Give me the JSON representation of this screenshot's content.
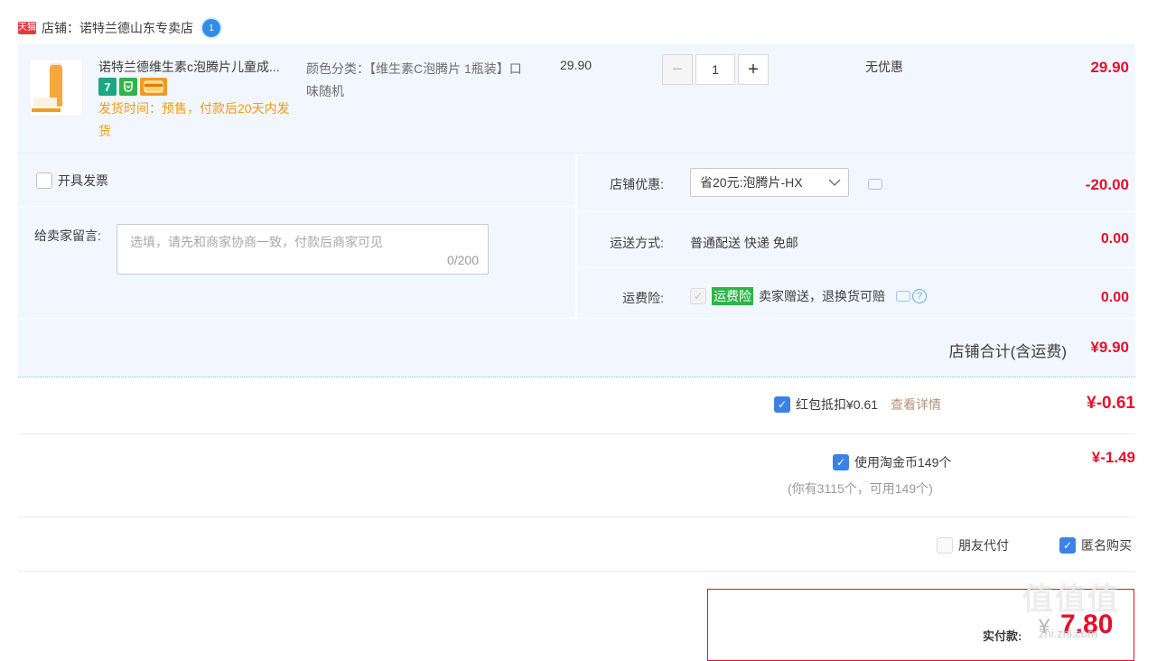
{
  "shop": {
    "tmall_badge": "天猫",
    "label": "店铺：诺特兰德山东专卖店",
    "wangwang_badge": "1"
  },
  "item": {
    "title": "诺特兰德维生素c泡腾片儿童成...",
    "badge_7": "7",
    "ship_time": "发货时间：预售，付款后20天内发货",
    "spec": "颜色分类：【维生素C泡腾片 1瓶装】口味随机",
    "price": "29.90",
    "quantity": "1",
    "qty_minus": "−",
    "qty_plus": "+",
    "discount": "无优惠",
    "total": "29.90"
  },
  "options": {
    "invoice_label": "开具发票",
    "message_label": "给卖家留言:",
    "message_placeholder": "选填，请先和商家协商一致，付款后商家可见",
    "message_count": "0/200",
    "shop_coupon_label": "店铺优惠:",
    "shop_coupon_value": "省20元:泡腾片-HX",
    "shop_coupon_amount": "-20.00",
    "shipping_label": "运送方式:",
    "shipping_value": "普通配送 快递 免邮",
    "shipping_amount": "0.00",
    "insurance_label": "运费险:",
    "insurance_tag": "运费险",
    "insurance_text": "卖家赠送，退换货可赔",
    "insurance_amount": "0.00"
  },
  "subtotal": {
    "label": "店铺合计(含运费)",
    "amount": "¥9.90"
  },
  "red_packet": {
    "label": "红包抵扣¥0.61",
    "link": "查看详情",
    "amount": "¥-0.61",
    "checked": true
  },
  "taojinbi": {
    "label": "使用淘金币149个",
    "note": "(你有3115个，可用149个)",
    "amount": "¥-1.49",
    "checked": true
  },
  "friend_pay": {
    "label": "朋友代付",
    "checked": false
  },
  "anonymous": {
    "label": "匿名购买",
    "checked": true
  },
  "payment": {
    "label": "实付款:",
    "yen": "¥",
    "amount": "7.80"
  },
  "watermark": {
    "text": "值值值",
    "sub": "zhi.zhi.com"
  },
  "colors": {
    "accent_red": "#e4102a",
    "panel_blue": "#f2f7ff",
    "checkbox_blue": "#3b82e6",
    "ship_orange": "#f29a14",
    "insurance_green": "#2fb44a"
  }
}
